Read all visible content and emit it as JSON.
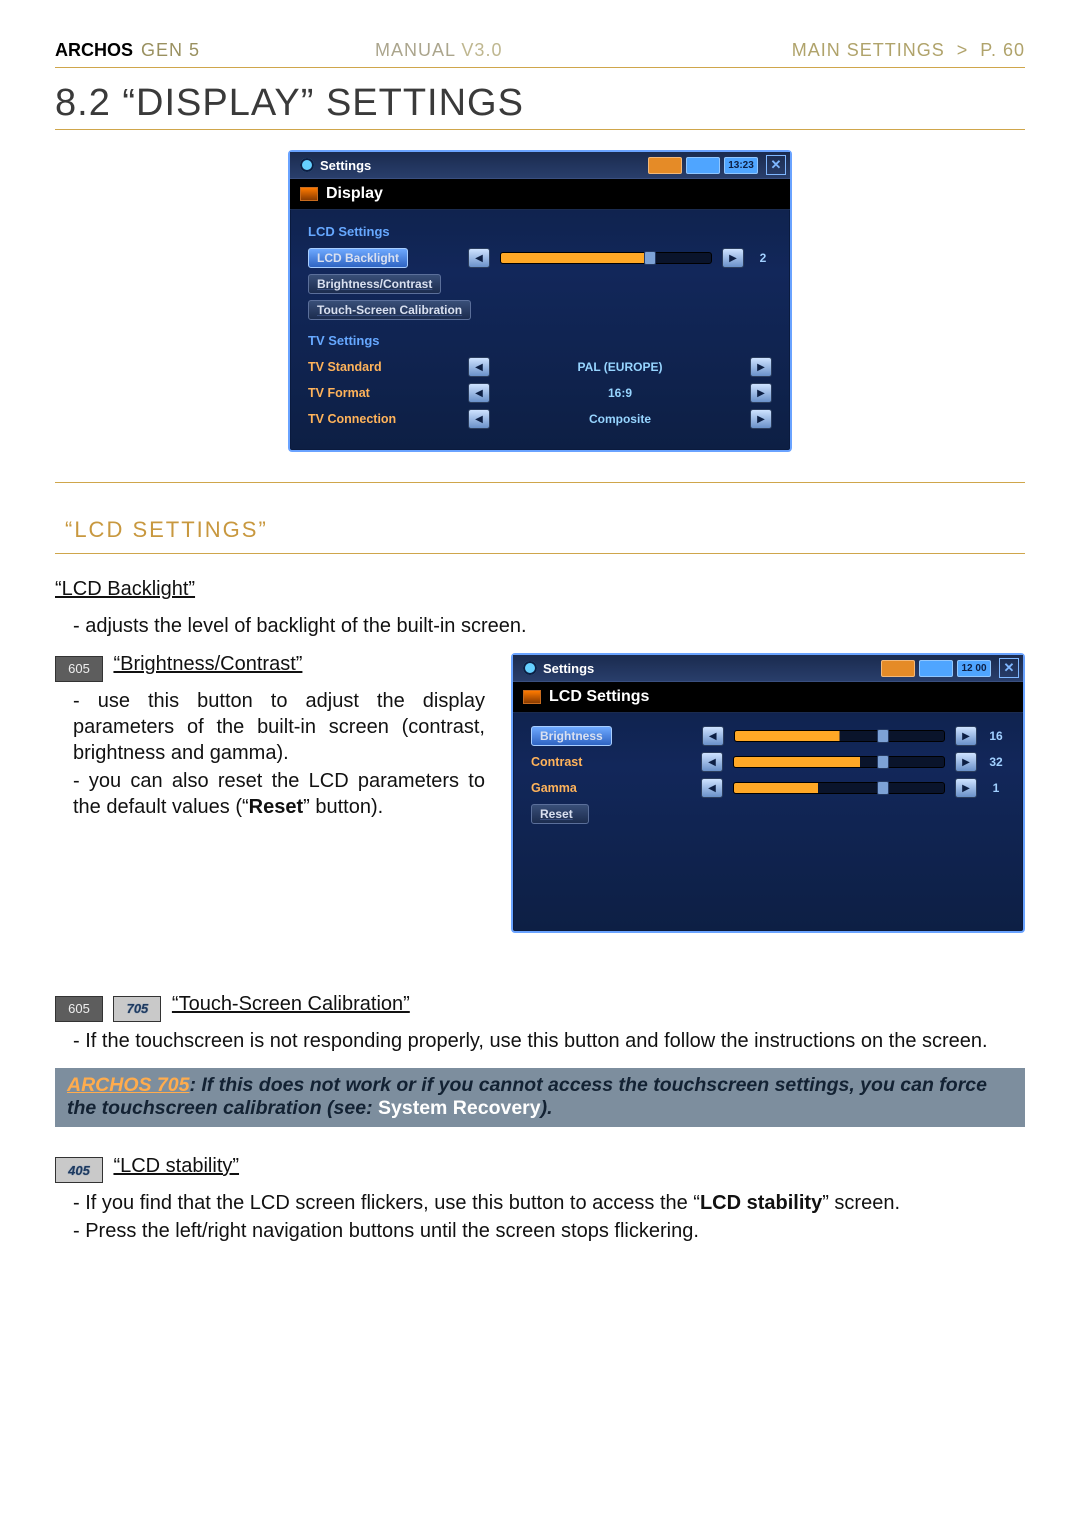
{
  "header": {
    "brand": "ARCHOS",
    "gen": "GEN 5",
    "manual": "MANUAL",
    "version": "V3.0",
    "breadcrumb": "MAIN SETTINGS",
    "sep": ">",
    "page": "P. 60"
  },
  "section_title": "8.2 “DISPLAY” SETTINGS",
  "screenshot_main": {
    "titlebar": "Settings",
    "time": "13:23",
    "subbar": "Display",
    "group1_label": "LCD Settings",
    "row_backlight": {
      "button": "LCD Backlight",
      "value": "2"
    },
    "row_bc": {
      "button": "Brightness/Contrast"
    },
    "row_touch": {
      "button": "Touch-Screen Calibration"
    },
    "group2_label": "TV Settings",
    "row_tvstd": {
      "label": "TV Standard",
      "value": "PAL (EUROPE)"
    },
    "row_tvfmt": {
      "label": "TV Format",
      "value": "16:9"
    },
    "row_tvcon": {
      "label": "TV Connection",
      "value": "Composite"
    }
  },
  "lcd_settings_heading": "“LCD SETTINGS”",
  "item_backlight": {
    "title": "“LCD Backlight”",
    "body": "adjusts the level of backlight of the built-in screen."
  },
  "item_bc": {
    "badge605": "605",
    "title": "“Brightness/Contrast”",
    "body1_a": "use this button to adjust the display parameters of the built-in screen (contrast, brightness and gamma).",
    "body2_a": "you can also reset the LCD param­",
    "body2_b": "eters to the default values (“",
    "body2_bold": "Reset",
    "body2_c": "” button)."
  },
  "screenshot_lcd": {
    "titlebar": "Settings",
    "time": "12 00",
    "subbar": "LCD Settings",
    "row_br": {
      "button": "Brightness",
      "value": "16"
    },
    "row_co": {
      "label": "Contrast",
      "value": "32"
    },
    "row_ga": {
      "label": "Gamma",
      "value": "1"
    },
    "reset": "Reset"
  },
  "item_touch": {
    "badge605": "605",
    "badge705": "705",
    "title": "“Touch-Screen Calibration”",
    "body_a": "If the touchscreen is not responding properly, use this button and follow the in",
    "body_b": "structions on the screen."
  },
  "note": {
    "hl": "ARCHOS 705",
    "mid": ": If this does not work or if you cannot access the touchscreen settings, you can force the touchscreen calibration (see: ",
    "white": "System Recovery",
    "end": ")."
  },
  "item_stability": {
    "badge405": "405",
    "title": "“LCD stability”",
    "body1_a": "If you find that the LCD screen flickers, use this button to access the “",
    "body1_bold": "LCD stabil­ity",
    "body1_b": "” screen.",
    "body2": "Press the left/right navigation buttons until the screen stops flickering."
  }
}
